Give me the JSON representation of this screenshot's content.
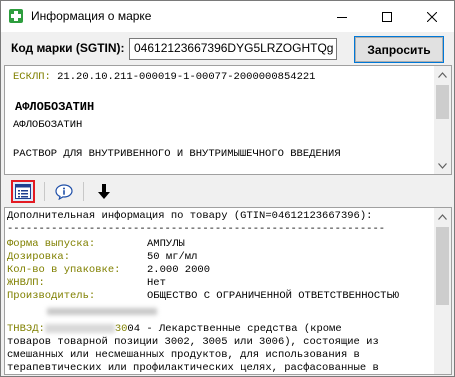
{
  "window": {
    "title": "Информация о марке",
    "icon": "green-cross-icon",
    "controls": [
      "minimize-icon",
      "maximize-icon",
      "close-icon"
    ]
  },
  "codebar": {
    "label": "Код марки (SGTIN):",
    "value": "04612123667396DYG5LRZOGHTQg",
    "request_button": "Запросить"
  },
  "top_pane": {
    "esklp_label": "ЕСКЛП:",
    "esklp_value": "21.20.10.211-000019-1-00077-2000000854221",
    "product_name": "АФЛОБОЗАТИН",
    "product_subname": "АФЛОБОЗАТИН",
    "form_line": "РАСТВОР ДЛЯ ВНУТРИВЕННОГО И ВНУТРИМЫШЕЧНОГО ВВЕДЕНИЯ"
  },
  "toolbar": {
    "buttons": [
      {
        "icon": "list-details-icon",
        "active": true
      },
      {
        "icon": "info-icon",
        "active": false
      },
      {
        "icon": "down-arrow-icon",
        "active": false
      }
    ]
  },
  "bottom_pane": {
    "header": "Дополнительная информация по товару (GTIN=04612123667396):",
    "separator": "------------------------------------------------------------",
    "fields": [
      {
        "label": "Форма выпуска:",
        "value": "АМПУЛЫ"
      },
      {
        "label": "Дозировка:",
        "value": "50 мг/мл"
      },
      {
        "label": "Кол-во в упаковке:",
        "value": "2.000 2000"
      },
      {
        "label": "ЖНВЛП:",
        "value": "Нет"
      },
      {
        "label": "Производитель:",
        "value": "ОБЩЕСТВО С ОГРАНИЧЕННОЙ ОТВЕТСТВЕННОСТЬЮ"
      }
    ],
    "tnved_label": "ТНВЭД:",
    "tnved_code_prefix": "30",
    "tnved_code_rest": "04 - Лекарственные средства (кроме",
    "tnved_lines": [
      "товаров товарной позиции 3002, 3005 или 3006), состоящие из",
      "смешанных или несмешанных продуктов, для использования в",
      "терапевтических или профилактических целях, расфасованные в"
    ]
  },
  "colors": {
    "label_olive": "#808000",
    "active_border": "#e31b23",
    "focus_blue": "#0078d7"
  }
}
